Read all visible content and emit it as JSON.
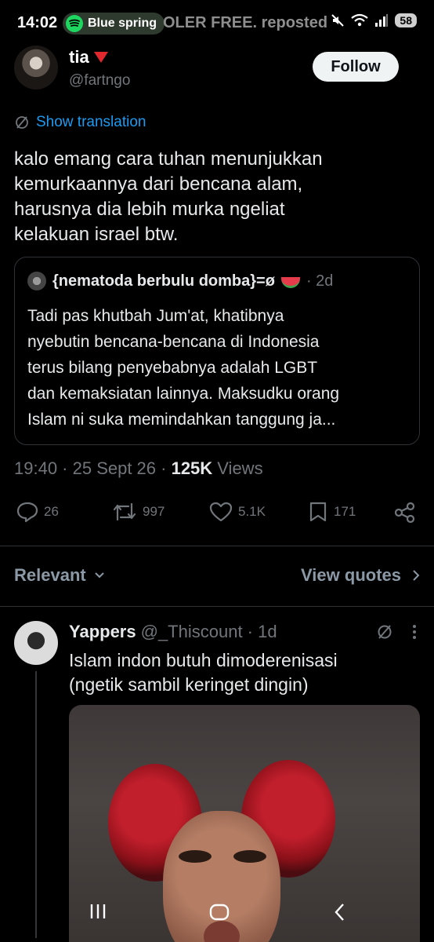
{
  "status_bar": {
    "time": "14:02",
    "now_playing": "Blue spring",
    "marquee": "OLER FREE. reposted",
    "battery": "58"
  },
  "tweet": {
    "author_name": "tia",
    "author_handle": "@fartngo",
    "follow_label": "Follow",
    "translate_label": "Show translation",
    "text_lines": [
      "kalo emang cara tuhan menunjukkan",
      "kemurkaannya dari bencana alam,",
      "harusnya dia lebih murka ngeliat",
      "kelakuan israel btw."
    ],
    "quote": {
      "name": "{nematoda berbulu domba}=ø",
      "time": "· 2d",
      "text_lines": [
        "Tadi pas khutbah Jum'at, khatibnya",
        "nyebutin bencana-bencana di Indonesia",
        "terus bilang penyebabnya adalah LGBT",
        "dan kemaksiatan lainnya. Maksudku orang",
        "Islam ni suka memindahkan tanggung ja..."
      ]
    },
    "timestamp": "19:40 · 25 Sept 26 · ",
    "views_count": "125K",
    "views_label": " Views",
    "stats": {
      "replies": "26",
      "reposts": "997",
      "likes": "5.1K",
      "bookmarks": "171"
    }
  },
  "sort": {
    "relevant_label": "Relevant",
    "view_quotes_label": "View quotes"
  },
  "reply": {
    "name": "Yappers",
    "handle": "@_Thiscount · 1d",
    "text_lines": [
      "Islam indon butuh dimoderenisasi",
      "(ngetik sambil keringet dingin)"
    ]
  },
  "colors": {
    "accent": "#1d9bf0",
    "muted": "#71767b",
    "background": "#000000"
  }
}
